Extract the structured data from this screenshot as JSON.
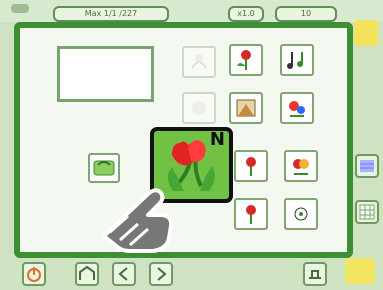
{
  "topbar": {
    "field1": "Max 1/1 /227",
    "field2": "x1.0",
    "field3": "10"
  },
  "bigTile": {
    "badge": "N"
  },
  "colors": {
    "panelGreen": "#3e8f33",
    "bg": "#cfe3c2",
    "tileBorder": "#7ea671",
    "highlight": "#71c244"
  }
}
